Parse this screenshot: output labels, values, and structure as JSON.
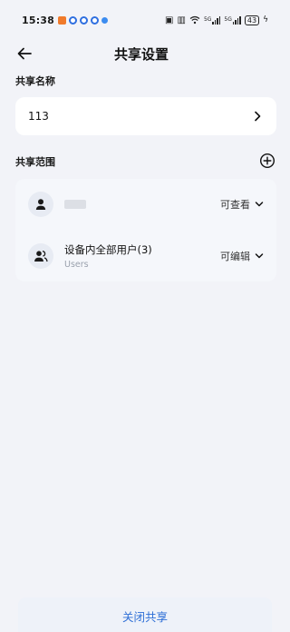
{
  "status_bar": {
    "time": "15:38",
    "battery": "43",
    "net_label": "5G"
  },
  "header": {
    "title": "共享设置",
    "back_icon": "arrow-left-icon"
  },
  "share_name": {
    "label": "共享名称",
    "value": "113"
  },
  "share_scope": {
    "label": "共享范围",
    "add_icon": "plus-circle-icon",
    "users": [
      {
        "name": "",
        "sub": "",
        "permission": "可查看",
        "icon": "person-icon",
        "name_redacted": true
      },
      {
        "name": "设备内全部用户(3)",
        "sub": "Users",
        "permission": "可编辑",
        "icon": "people-icon"
      }
    ]
  },
  "footer": {
    "close_share_label": "关闭共享"
  },
  "colors": {
    "background": "#f2f3f8",
    "accent": "#2e6fd6"
  }
}
